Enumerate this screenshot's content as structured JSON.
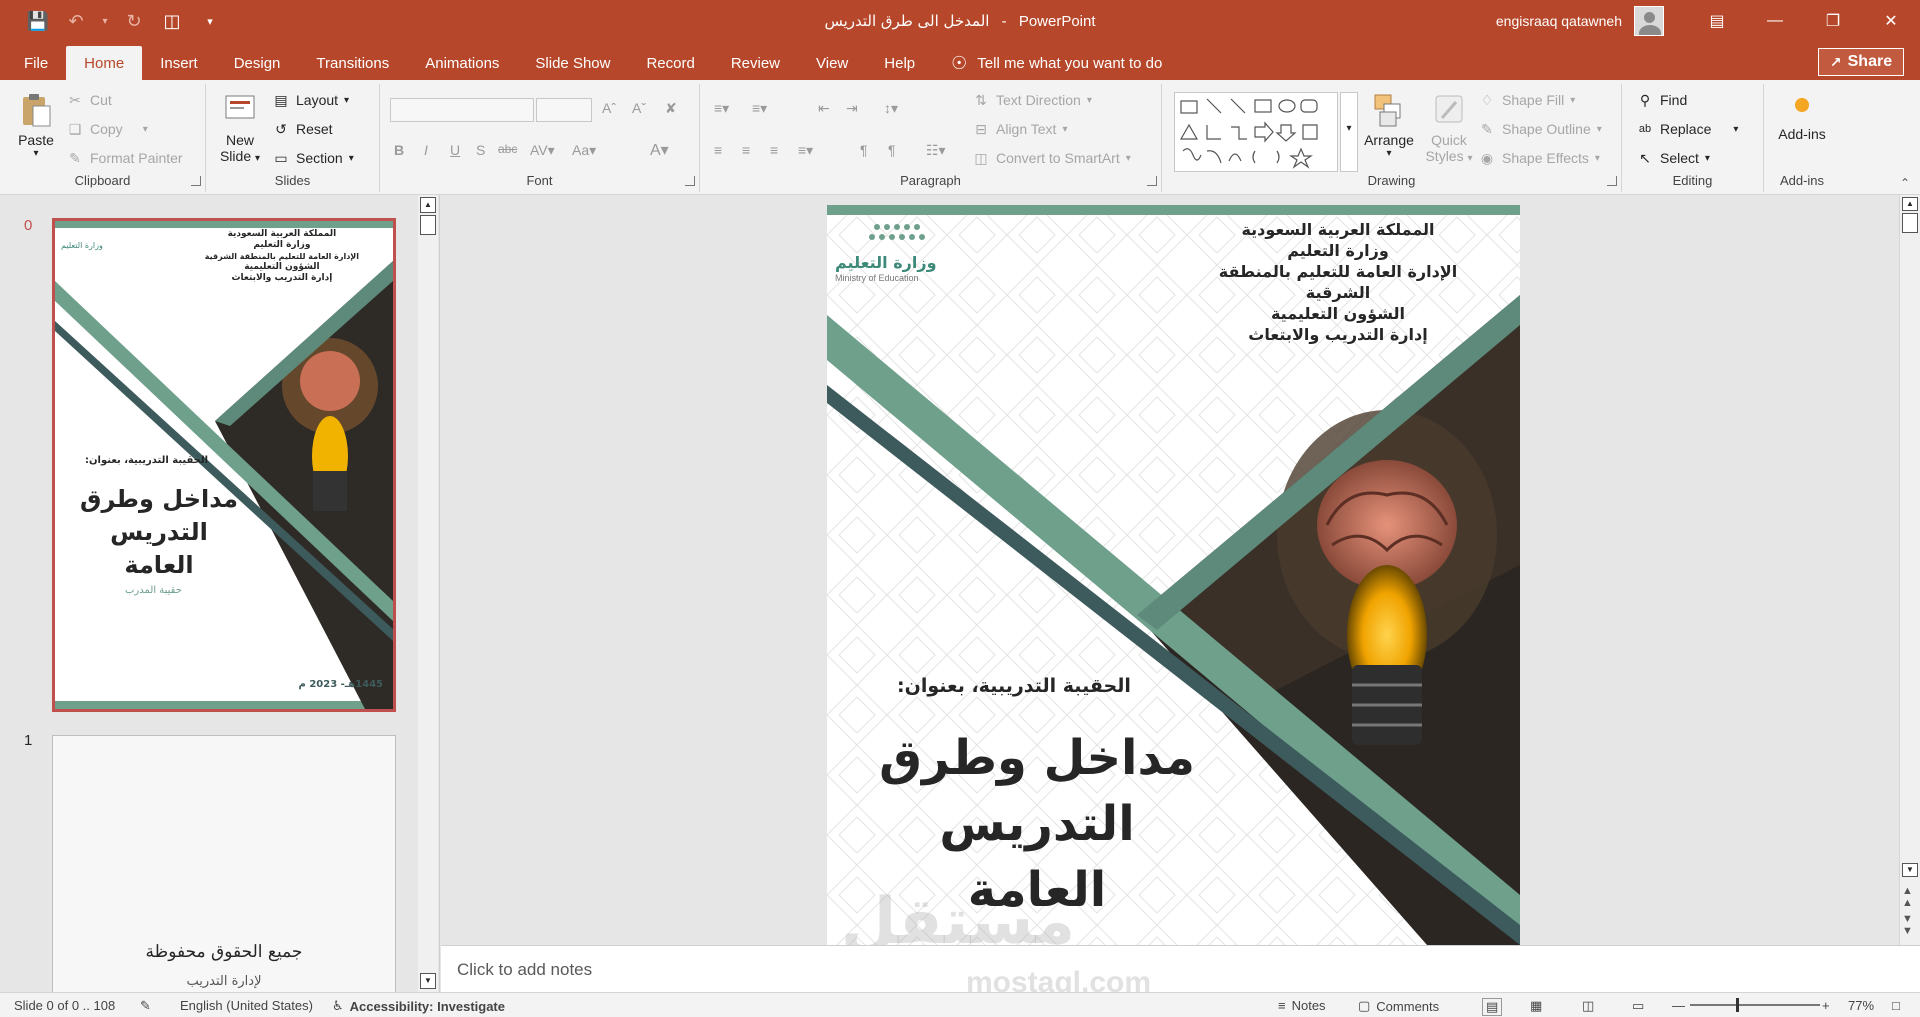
{
  "window": {
    "doc_title": "المدخل الى طرق التدريس",
    "separator": "-",
    "app_name": "PowerPoint",
    "user_name": "engisraaq qatawneh"
  },
  "tabs": [
    "File",
    "Home",
    "Insert",
    "Design",
    "Transitions",
    "Animations",
    "Slide Show",
    "Record",
    "Review",
    "View",
    "Help"
  ],
  "tell_me": "Tell me what you want to do",
  "share_label": "Share",
  "ribbon": {
    "clipboard": {
      "name": "Clipboard",
      "paste": "Paste",
      "cut": "Cut",
      "copy": "Copy",
      "format_painter": "Format Painter"
    },
    "slides": {
      "name": "Slides",
      "new_slide_1": "New",
      "new_slide_2": "Slide",
      "layout": "Layout",
      "reset": "Reset",
      "section": "Section"
    },
    "font": {
      "name": "Font"
    },
    "paragraph": {
      "name": "Paragraph",
      "text_direction": "Text Direction",
      "align_text": "Align Text",
      "convert_smartart": "Convert to SmartArt"
    },
    "drawing": {
      "name": "Drawing",
      "arrange": "Arrange",
      "quick_styles_1": "Quick",
      "quick_styles_2": "Styles",
      "shape_fill": "Shape Fill",
      "shape_outline": "Shape Outline",
      "shape_effects": "Shape Effects"
    },
    "editing": {
      "name": "Editing",
      "find": "Find",
      "replace": "Replace",
      "select": "Select"
    },
    "addins": {
      "name": "Add-ins",
      "label": "Add-ins"
    }
  },
  "thumbnails": [
    {
      "number": "0",
      "header": [
        "المملكة العربية السعودية",
        "وزارة التعليم",
        "الإدارة العامة للتعليم بالمنطقة الشرقية",
        "الشؤون التعليمية",
        "إدارة التدريب والابتعاث"
      ],
      "subtitle": "الحقيبة التدريبية، بعنوان:",
      "title": [
        "مداخل وطرق",
        "التدريس",
        "العامة"
      ],
      "tag": "حقيبة المدرب",
      "date": "1445هـ- 2023 م"
    },
    {
      "number": "1",
      "line1": "جميع الحقوق محفوظة",
      "line2": "لإدارة التدريب"
    }
  ],
  "slide": {
    "logo_ar": "وزارة التعليم",
    "logo_en": "Ministry of Education",
    "header": [
      "المملكة العربية السعودية",
      "وزارة التعليم",
      "الإدارة العامة للتعليم بالمنطقة الشرقية",
      "الشؤون التعليمية",
      "إدارة التدريب والابتعاث"
    ],
    "subtitle": "الحقيبة التدريبية، بعنوان:",
    "title": [
      "مداخل وطرق",
      "التدريس",
      "العامة"
    ]
  },
  "notes_placeholder": "Click to add notes",
  "watermark": {
    "ar": "مستقل",
    "en": "mostaql.com"
  },
  "status": {
    "slide_info": "Slide 0 of 0 .. 108",
    "language": "English (United States)",
    "accessibility": "Accessibility: Investigate",
    "notes": "Notes",
    "comments": "Comments",
    "zoom": "77%"
  },
  "colors": {
    "accent": "#b7472a",
    "teal": "#6ea08c",
    "dark_teal": "#3d5a5c"
  }
}
